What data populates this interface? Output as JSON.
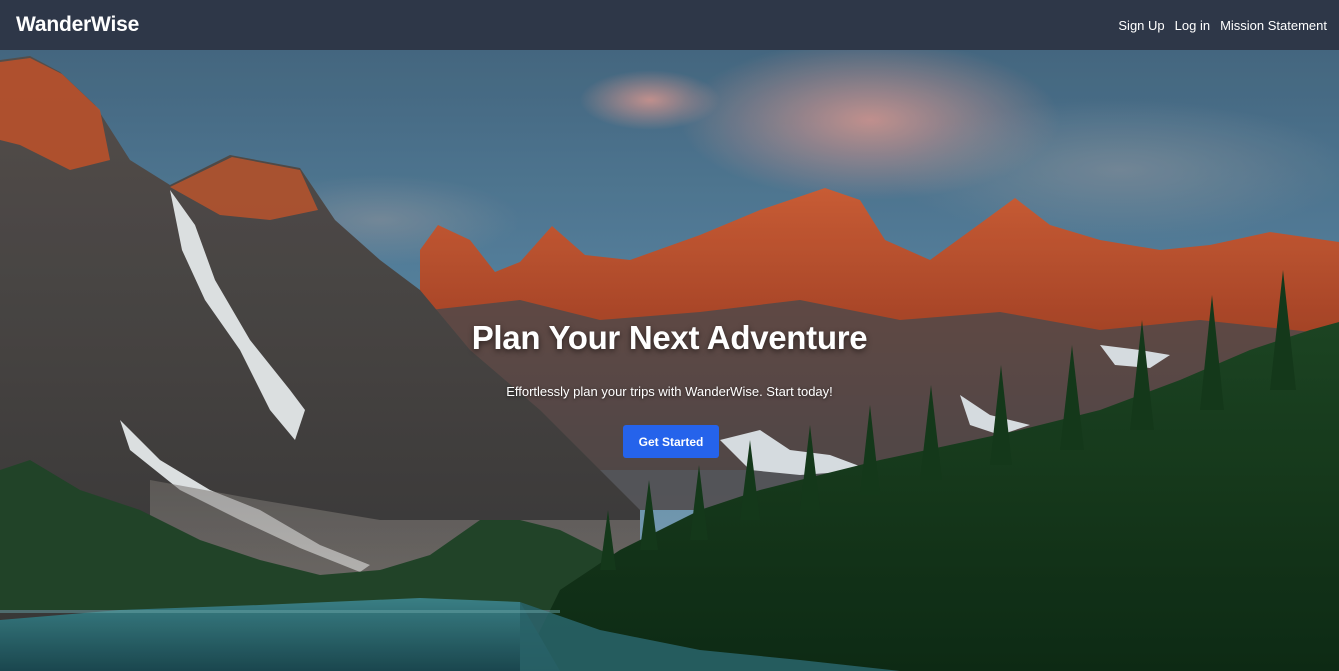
{
  "header": {
    "brand": "WanderWise",
    "nav": [
      {
        "label": "Sign Up"
      },
      {
        "label": "Log in"
      },
      {
        "label": "Mission Statement"
      }
    ]
  },
  "hero": {
    "title": "Plan Your Next Adventure",
    "subtitle": "Effortlessly plan your trips with WanderWise. Start today!",
    "cta_label": "Get Started"
  },
  "colors": {
    "header_bg": "#2e3748",
    "cta_bg": "#2563eb",
    "text": "#ffffff"
  }
}
